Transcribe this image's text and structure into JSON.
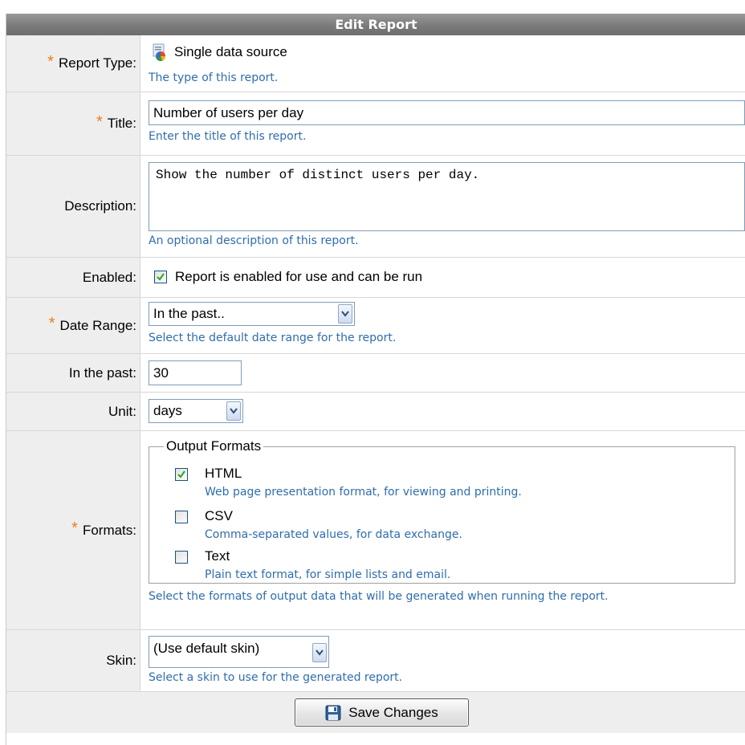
{
  "header": {
    "title": "Edit Report"
  },
  "report_type": {
    "label": "Report Type:",
    "value": "Single data source",
    "hint": "The type of this report.",
    "icon": "database-report-icon"
  },
  "title": {
    "label": "Title:",
    "value": "Number of users per day",
    "hint": "Enter the title of this report."
  },
  "description": {
    "label": "Description:",
    "value": "Show the number of distinct users per day.",
    "hint": "An optional description of this report."
  },
  "enabled": {
    "label": "Enabled:",
    "checkbox_label": "Report is enabled for use and can be run",
    "checked": true
  },
  "date_range": {
    "label": "Date Range:",
    "selected": "In the past..",
    "hint": "Select the default date range for the report."
  },
  "in_the_past": {
    "label": "In the past:",
    "value": "30"
  },
  "unit": {
    "label": "Unit:",
    "selected": "days"
  },
  "formats": {
    "label": "Formats:",
    "legend": "Output Formats",
    "options": [
      {
        "name": "HTML",
        "description": "Web page presentation format, for viewing and printing.",
        "checked": true
      },
      {
        "name": "CSV",
        "description": "Comma-separated values, for data exchange.",
        "checked": false
      },
      {
        "name": "Text",
        "description": "Plain text format, for simple lists and email.",
        "checked": false
      }
    ],
    "hint": "Select the formats of output data that will be generated when running the report."
  },
  "skin": {
    "label": "Skin:",
    "selected": "(Use default skin)",
    "hint": "Select a skin to use for the generated report."
  },
  "footer": {
    "save_label": "Save Changes"
  },
  "colors": {
    "required_marker": "#f07b14",
    "hint_text": "#2f6dad",
    "header_bg": "#7b7b7b",
    "label_bg": "#eeeeee"
  }
}
